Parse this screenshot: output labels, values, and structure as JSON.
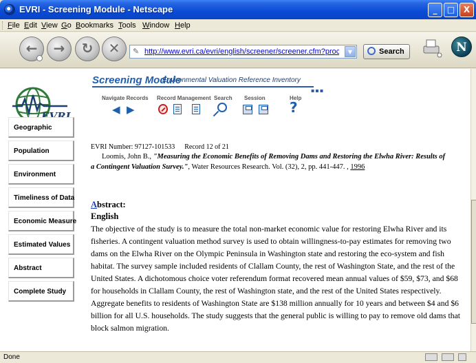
{
  "window": {
    "title": "EVRI - Screening Module - Netscape",
    "controls": {
      "minimize": "_",
      "maximize": "□",
      "close": "X"
    }
  },
  "menubar": {
    "items": [
      "File",
      "Edit",
      "View",
      "Go",
      "Bookmarks",
      "Tools",
      "Window",
      "Help"
    ]
  },
  "navbar": {
    "url": "http://www.evri.ca/evri/english/screener/screener.cfm?process=next&",
    "search_label": "Search",
    "icons": [
      "back-icon",
      "forward-icon",
      "reload-icon",
      "stop-icon",
      "print-icon",
      "netscape-logo-icon"
    ],
    "logo_letter": "N"
  },
  "page": {
    "logo_text": "EVRI",
    "module_title": "Screening Module",
    "module_subtitle": "Environmental Valuation Reference Inventory",
    "toolbar": {
      "navigate_records": "Navigate Records",
      "record_management": "Record Management",
      "search": "Search",
      "session": "Session",
      "help": "Help"
    },
    "sidebar": [
      "Geographic",
      "Population",
      "Environment",
      "Timeliness of Data",
      "Economic Measure",
      "Estimated Values",
      "Abstract",
      "Complete Study"
    ],
    "record": {
      "number": "EVRI Number: 97127-101533",
      "position": "Record 12 of 21",
      "author": "Loomis, John B., ",
      "title_part1": "\"Measuring the Economic Benefits of Removing Dams and Restoring the Elwha River: Results of",
      "title_part2": "a Contingent Valuation Survey.\"",
      "journal": ", Water Resources Research. Vol. (32), 2, pp. 441-447. , ",
      "year": "1996"
    },
    "abstract": {
      "heading_first": "A",
      "heading_rest": "bstract:",
      "language": "English",
      "body": "The objective of the study is to measure the total non-market economic value for restoring Elwha River and its fisheries. A contingent valuation method survey is used to obtain willingness-to-pay estimates for removing two dams on the Elwha River on the Olympic Peninsula in Washington state and restoring the eco-system and fish habitat. The survey sample included residents of Clallam County, the rest of Washington State, and the rest of the United States. A dichotomous choice voter referendum format recovered mean annual values of $59, $73, and $68 for households in Clallam County, the rest of Washington state, and the rest of the United States respectively. Aggregate benefits to residents of Washington State are $138 million annually for 10 years and between $4 and $6 billion for all U.S. households. The study suggests that the general public is willing to pay to remove old dams that block salmon migration."
    }
  },
  "statusbar": {
    "text": "Done"
  }
}
